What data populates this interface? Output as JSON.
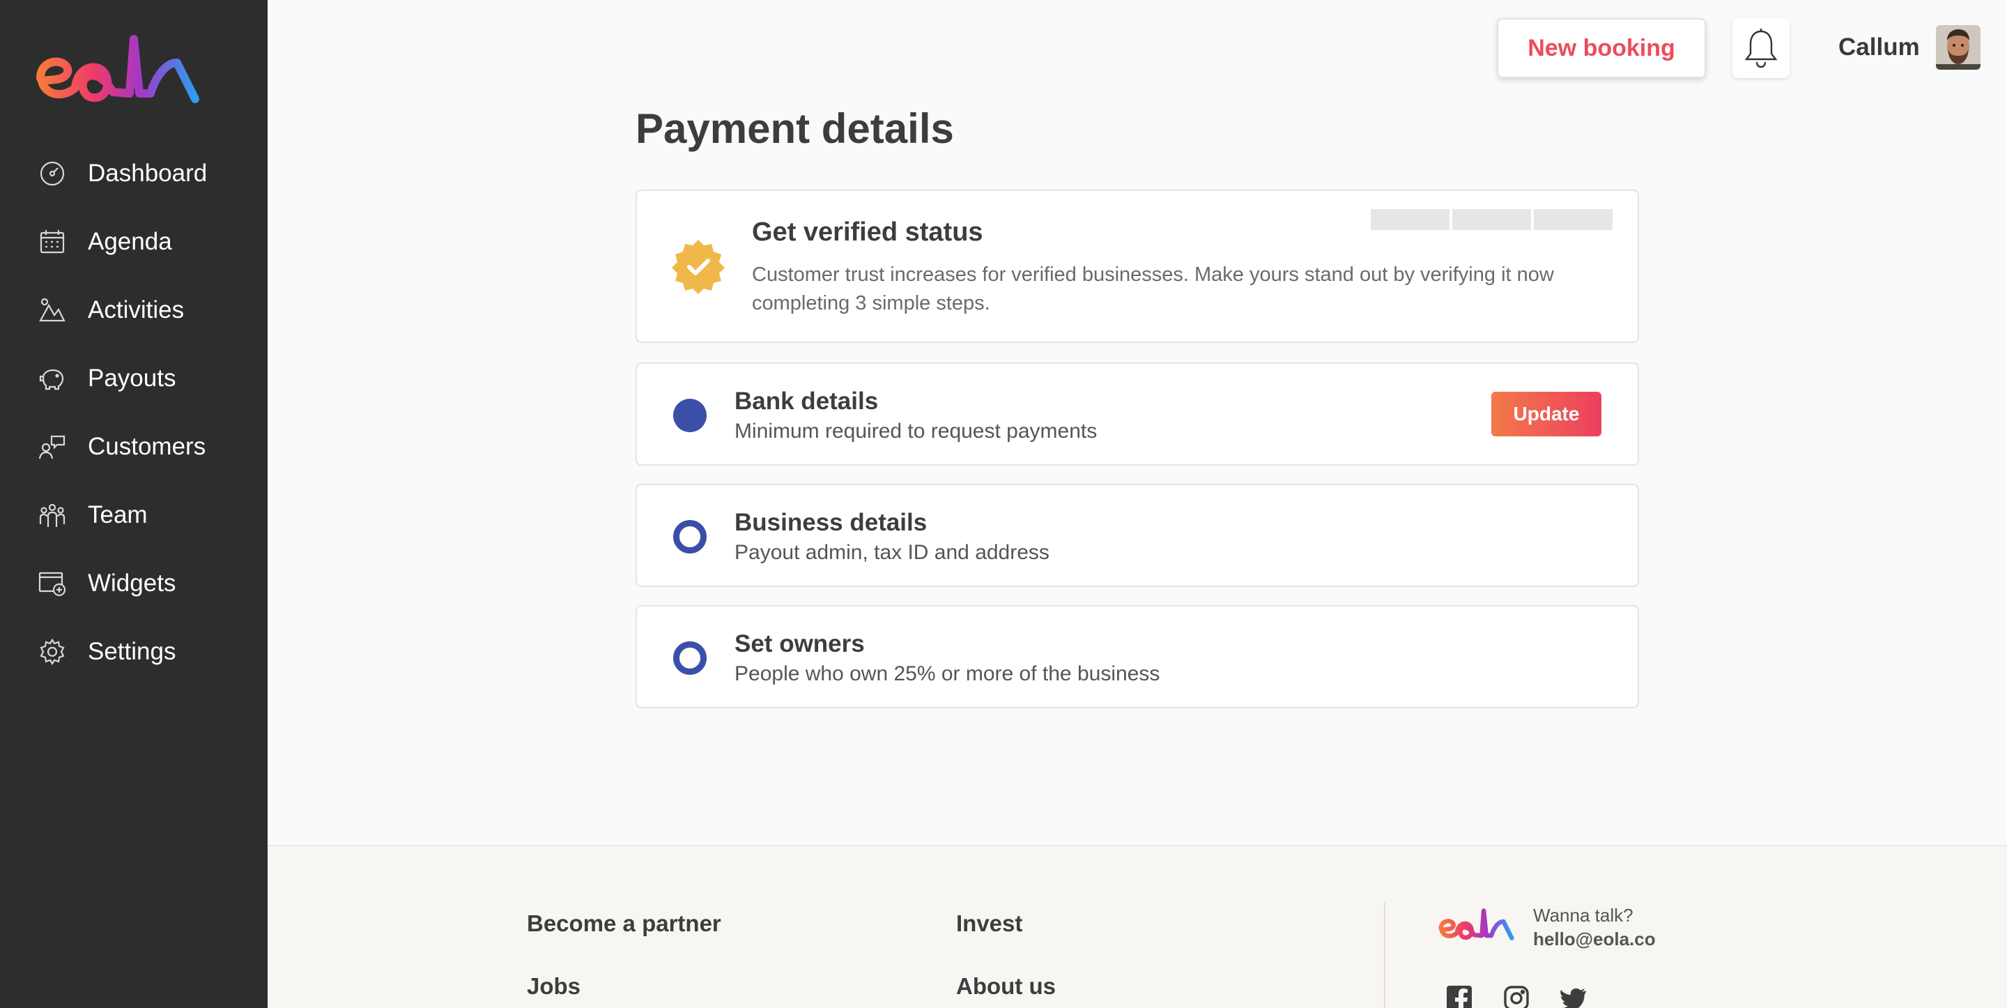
{
  "brand": {
    "logo_text": "eola",
    "colors": {
      "sidebar_bg": "#2d2d2d",
      "accent": "#ee4b5a",
      "step_blue": "#3c4fa8",
      "badge_gold": "#f0b84a"
    }
  },
  "sidebar": {
    "items": [
      {
        "label": "Dashboard",
        "icon": "dashboard-icon"
      },
      {
        "label": "Agenda",
        "icon": "calendar-icon"
      },
      {
        "label": "Activities",
        "icon": "activities-icon"
      },
      {
        "label": "Payouts",
        "icon": "piggy-bank-icon"
      },
      {
        "label": "Customers",
        "icon": "customers-icon"
      },
      {
        "label": "Team",
        "icon": "team-icon"
      },
      {
        "label": "Widgets",
        "icon": "widgets-icon"
      },
      {
        "label": "Settings",
        "icon": "gear-icon"
      }
    ]
  },
  "header": {
    "new_booking_label": "New booking",
    "user_name": "Callum"
  },
  "main": {
    "title": "Payment details",
    "verified": {
      "title": "Get verified status",
      "description": "Customer trust increases for verified businesses. Make yours stand out by verifying it now completing 3 simple steps.",
      "steps_total": 3,
      "steps_completed": 0
    },
    "steps": [
      {
        "title": "Bank details",
        "description": "Minimum required to request payments",
        "state": "filled",
        "action_label": "Update"
      },
      {
        "title": "Business details",
        "description": "Payout admin, tax ID and address",
        "state": "open"
      },
      {
        "title": "Set owners",
        "description": "People who own 25% or more of the business",
        "state": "open"
      }
    ]
  },
  "footer": {
    "links": {
      "become_partner": "Become a partner",
      "invest": "Invest",
      "jobs": "Jobs",
      "about_us": "About us"
    },
    "contact": {
      "label": "Wanna talk?",
      "email": "hello@eola.co"
    },
    "social": [
      "facebook-icon",
      "instagram-icon",
      "twitter-icon"
    ]
  }
}
